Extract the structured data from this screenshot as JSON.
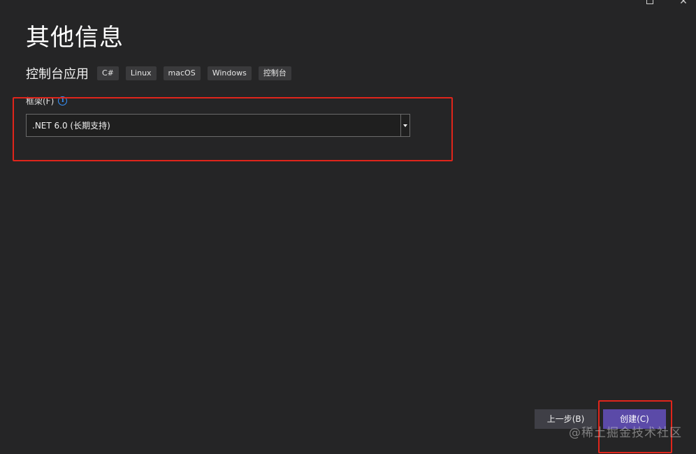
{
  "page": {
    "title": "其他信息"
  },
  "template": {
    "name": "控制台应用",
    "tags": [
      "C#",
      "Linux",
      "macOS",
      "Windows",
      "控制台"
    ]
  },
  "framework": {
    "label": "框架(F)",
    "selected": ".NET 6.0 (长期支持)"
  },
  "footer": {
    "back_label": "上一步(B)",
    "create_label": "创建(C)"
  },
  "watermark": {
    "text": "@稀土掘金技术社区"
  },
  "colors": {
    "background": "#252526",
    "accent_button": "#5b4aa8",
    "highlight_border": "#e0251b",
    "info_icon": "#3794ff"
  }
}
